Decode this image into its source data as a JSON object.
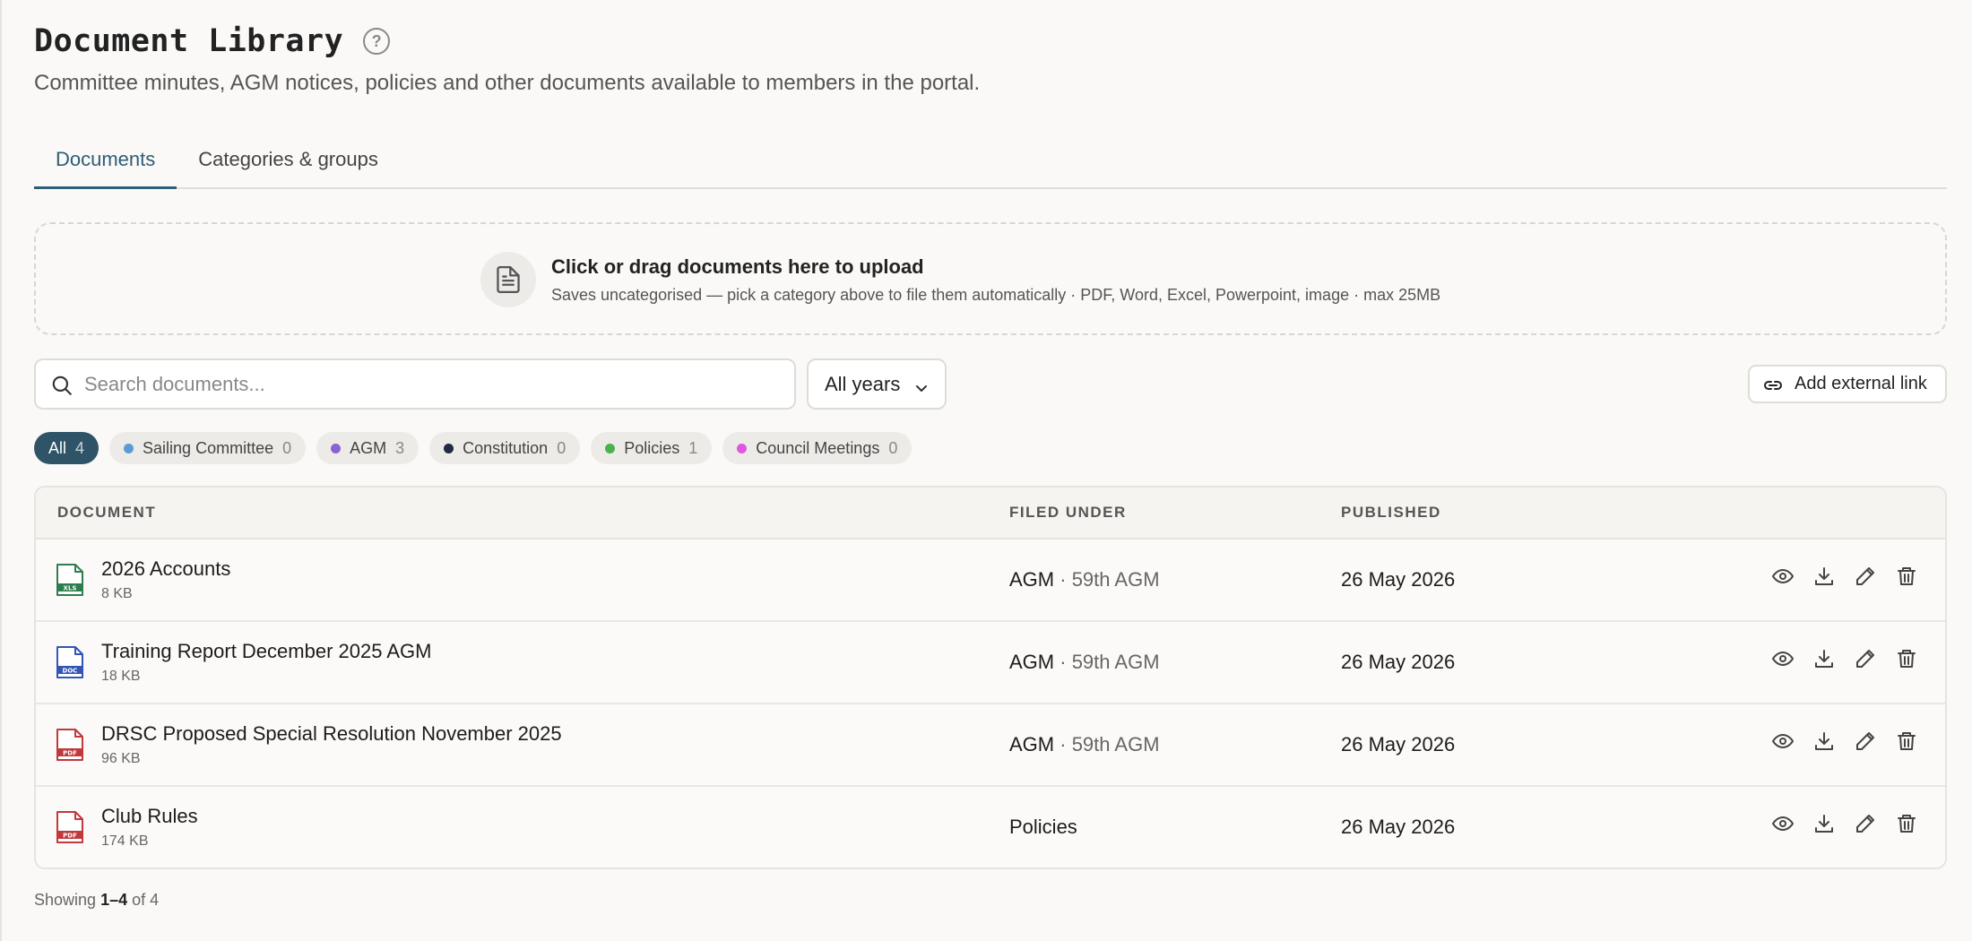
{
  "header": {
    "title": "Document Library",
    "help_icon": "question-circle-icon",
    "subtitle": "Committee minutes, AGM notices, policies and other documents available to members in the portal."
  },
  "tabs": [
    {
      "label": "Documents",
      "active": true
    },
    {
      "label": "Categories & groups",
      "active": false
    }
  ],
  "upload": {
    "icon": "document-icon",
    "title": "Click or drag documents here to upload",
    "subtitle": "Saves uncategorised — pick a category above to file them automatically · PDF, Word, Excel, Powerpoint, image · max 25MB"
  },
  "search": {
    "placeholder": "Search documents...",
    "value": ""
  },
  "year_filter": {
    "selected": "All years"
  },
  "external_link_button": {
    "label": "Add external link",
    "icon": "link-icon"
  },
  "chips": [
    {
      "label": "All",
      "count": "4",
      "active": true,
      "color": ""
    },
    {
      "label": "Sailing Committee",
      "count": "0",
      "active": false,
      "color": "#5b9bd5"
    },
    {
      "label": "AGM",
      "count": "3",
      "active": false,
      "color": "#8a63d2"
    },
    {
      "label": "Constitution",
      "count": "0",
      "active": false,
      "color": "#1f2a44"
    },
    {
      "label": "Policies",
      "count": "1",
      "active": false,
      "color": "#4caf50"
    },
    {
      "label": "Council Meetings",
      "count": "0",
      "active": false,
      "color": "#e056e0"
    }
  ],
  "table": {
    "columns": {
      "document": "DOCUMENT",
      "filed_under": "FILED UNDER",
      "published": "PUBLISHED"
    },
    "rows": [
      {
        "name": "2026 Accounts",
        "size": "8 KB",
        "type": "XLS",
        "type_color": "#2e7d4f",
        "filed_main": "AGM",
        "filed_sub": "· 59th AGM",
        "published": "26 May 2026"
      },
      {
        "name": "Training Report December 2025 AGM",
        "size": "18 KB",
        "type": "DOC",
        "type_color": "#3355b5",
        "filed_main": "AGM",
        "filed_sub": "· 59th AGM",
        "published": "26 May 2026"
      },
      {
        "name": "DRSC Proposed Special Resolution November 2025",
        "size": "96 KB",
        "type": "PDF",
        "type_color": "#c0393b",
        "filed_main": "AGM",
        "filed_sub": "· 59th AGM",
        "published": "26 May 2026"
      },
      {
        "name": "Club Rules",
        "size": "174 KB",
        "type": "PDF",
        "type_color": "#c0393b",
        "filed_main": "Policies",
        "filed_sub": "",
        "published": "26 May 2026"
      }
    ],
    "row_actions": [
      "eye-icon",
      "download-icon",
      "pencil-icon",
      "trash-icon"
    ]
  },
  "footer": {
    "prefix": "Showing",
    "range": "1–4",
    "middle": "of",
    "total": "4"
  }
}
